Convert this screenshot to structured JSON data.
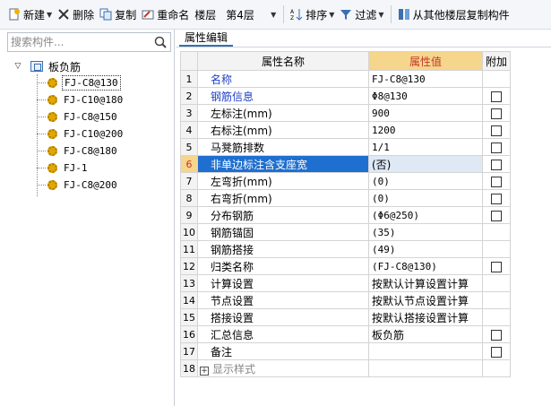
{
  "toolbar": {
    "new_label": "新建",
    "delete_label": "删除",
    "copy_label": "复制",
    "rename_label": "重命名",
    "floor_label": "楼层",
    "floor_value": "第4层",
    "sort_label": "排序",
    "filter_label": "过滤",
    "copy_from_floor_label": "从其他楼层复制构件"
  },
  "search": {
    "placeholder": "搜索构件..."
  },
  "tree": {
    "root_label": "板负筋",
    "items": [
      {
        "label": "FJ-C8@130",
        "selected": true
      },
      {
        "label": "FJ-C10@180"
      },
      {
        "label": "FJ-C8@150"
      },
      {
        "label": "FJ-C10@200"
      },
      {
        "label": "FJ-C8@180"
      },
      {
        "label": "FJ-1"
      },
      {
        "label": "FJ-C8@200"
      }
    ]
  },
  "panel": {
    "tab_label": "属性编辑",
    "headers": {
      "name": "属性名称",
      "value": "属性值",
      "extra": "附加"
    },
    "rows": [
      {
        "n": "1",
        "name": "名称",
        "value": "FJ-C8@130",
        "check": false
      },
      {
        "n": "2",
        "name": "钢筋信息",
        "value": "Φ8@130",
        "check": true
      },
      {
        "n": "3",
        "name": "左标注(mm)",
        "value": "900",
        "check": true
      },
      {
        "n": "4",
        "name": "右标注(mm)",
        "value": "1200",
        "check": true
      },
      {
        "n": "5",
        "name": "马凳筋排数",
        "value": "1/1",
        "check": true
      },
      {
        "n": "6",
        "name": "非单边标注含支座宽",
        "value": "(否)",
        "check": true
      },
      {
        "n": "7",
        "name": "左弯折(mm)",
        "value": "(0)",
        "check": true
      },
      {
        "n": "8",
        "name": "右弯折(mm)",
        "value": "(0)",
        "check": true
      },
      {
        "n": "9",
        "name": "分布钢筋",
        "value": "(Φ6@250)",
        "check": true
      },
      {
        "n": "10",
        "name": "钢筋锚固",
        "value": "(35)",
        "check": false
      },
      {
        "n": "11",
        "name": "钢筋搭接",
        "value": "(49)",
        "check": false
      },
      {
        "n": "12",
        "name": "归类名称",
        "value": "(FJ-C8@130)",
        "check": true
      },
      {
        "n": "13",
        "name": "计算设置",
        "value": "按默认计算设置计算",
        "check": false
      },
      {
        "n": "14",
        "name": "节点设置",
        "value": "按默认节点设置计算",
        "check": false
      },
      {
        "n": "15",
        "name": "搭接设置",
        "value": "按默认搭接设置计算",
        "check": false
      },
      {
        "n": "16",
        "name": "汇总信息",
        "value": "板负筋",
        "check": true
      },
      {
        "n": "17",
        "name": "备注",
        "value": "",
        "check": true
      },
      {
        "n": "18",
        "name": "显示样式",
        "value": "",
        "check": false
      }
    ]
  }
}
